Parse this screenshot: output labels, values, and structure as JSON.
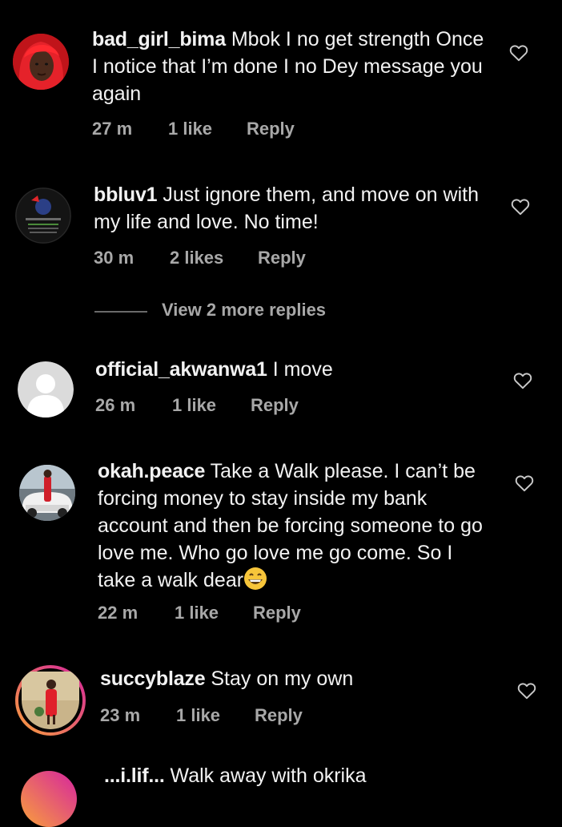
{
  "comments": [
    {
      "username": "bad_girl_bima",
      "text": " Mbok I no get strength Once I notice that I’m done I no Dey message you again",
      "time": "27 m",
      "likes": "1 like",
      "reply": "Reply"
    },
    {
      "username": "bbluv1",
      "text": " Just ignore them, and move on with my life and love. No time!",
      "time": "30 m",
      "likes": "2 likes",
      "reply": "Reply"
    },
    {
      "username": "official_akwanwa1",
      "text": " I move",
      "time": "26 m",
      "likes": "1 like",
      "reply": "Reply"
    },
    {
      "username": "okah.peace",
      "text": " Take a Walk please. I can’t be forcing money to stay inside my bank account and then be forcing someone to go love me. Who go love me go come. So I take a walk dear",
      "time": "22 m",
      "likes": "1 like",
      "reply": "Reply"
    },
    {
      "username": "succyblaze",
      "text": " Stay on my own",
      "time": "23 m",
      "likes": "1 like",
      "reply": "Reply"
    },
    {
      "username": "...i.lif...",
      "text": " Walk away with okrika",
      "time": "",
      "likes": "",
      "reply": ""
    }
  ],
  "view_more_replies": "View 2 more replies",
  "icons": {
    "like": "heart-outline-icon",
    "emoji": "grinning-face-emoji"
  },
  "colors": {
    "background": "#000000",
    "text": "#f2f2f2",
    "meta": "#a8a8a8",
    "story_ring_start": "#f9a13a",
    "story_ring_end": "#d6249f"
  }
}
